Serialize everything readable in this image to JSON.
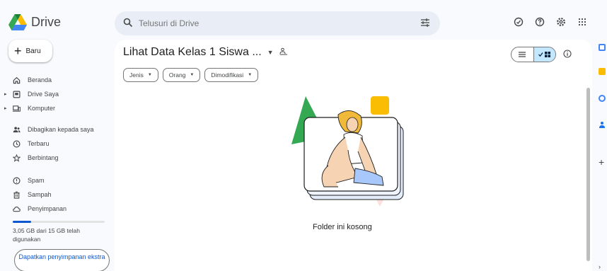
{
  "app": {
    "name": "Drive"
  },
  "search": {
    "placeholder": "Telusuri di Drive"
  },
  "sidebar": {
    "new_label": "Baru",
    "items": [
      {
        "label": "Beranda",
        "icon": "home-icon"
      },
      {
        "label": "Drive Saya",
        "icon": "my-drive-icon"
      },
      {
        "label": "Komputer",
        "icon": "computer-icon"
      },
      {
        "label": "Dibagikan kepada saya",
        "icon": "shared-icon"
      },
      {
        "label": "Terbaru",
        "icon": "clock-icon"
      },
      {
        "label": "Berbintang",
        "icon": "star-icon"
      },
      {
        "label": "Spam",
        "icon": "spam-icon"
      },
      {
        "label": "Sampah",
        "icon": "trash-icon"
      },
      {
        "label": "Penyimpanan",
        "icon": "cloud-icon"
      }
    ],
    "storage_text": "3,05 GB dari 15 GB telah digunakan",
    "storage_fraction": 0.2,
    "get_storage_label": "Dapatkan penyimpanan ekstra"
  },
  "main": {
    "title": "Lihat Data Kelas 1 Siswa ...",
    "filters": [
      "Jenis",
      "Orang",
      "Dimodifikasi"
    ],
    "empty_message": "Folder ini kosong"
  },
  "colors": {
    "accent": "#0b57d0",
    "selected_toggle": "#c2e7ff",
    "search_bg": "#e9eef6"
  }
}
